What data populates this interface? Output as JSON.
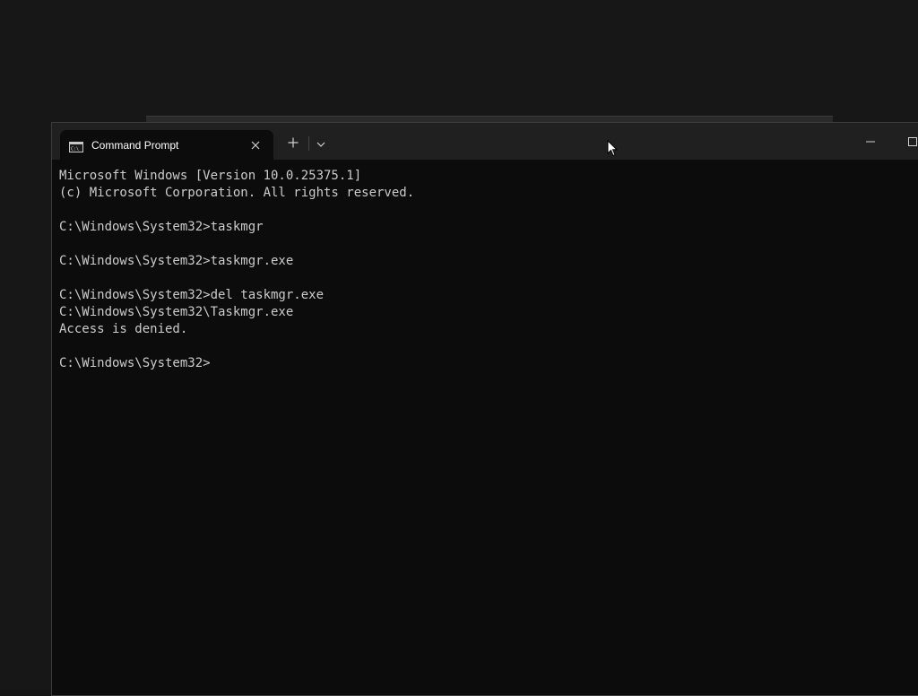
{
  "window": {
    "tab_title": "Command Prompt",
    "tab_icon": "cmd-icon",
    "close_icon": "close-icon",
    "new_tab_icon": "plus-icon",
    "dropdown_icon": "chevron-down-icon",
    "minimize_icon": "minimize-icon",
    "maximize_icon": "maximize-icon"
  },
  "console": {
    "lines": [
      "Microsoft Windows [Version 10.0.25375.1]",
      "(c) Microsoft Corporation. All rights reserved.",
      "",
      "C:\\Windows\\System32>taskmgr",
      "",
      "C:\\Windows\\System32>taskmgr.exe",
      "",
      "C:\\Windows\\System32>del taskmgr.exe",
      "C:\\Windows\\System32\\Taskmgr.exe",
      "Access is denied.",
      "",
      "C:\\Windows\\System32>"
    ]
  },
  "colors": {
    "console_background": "#0c0c0c",
    "console_text": "#cccccc",
    "title_bar": "#202020",
    "tab_title": "#ffffff"
  }
}
